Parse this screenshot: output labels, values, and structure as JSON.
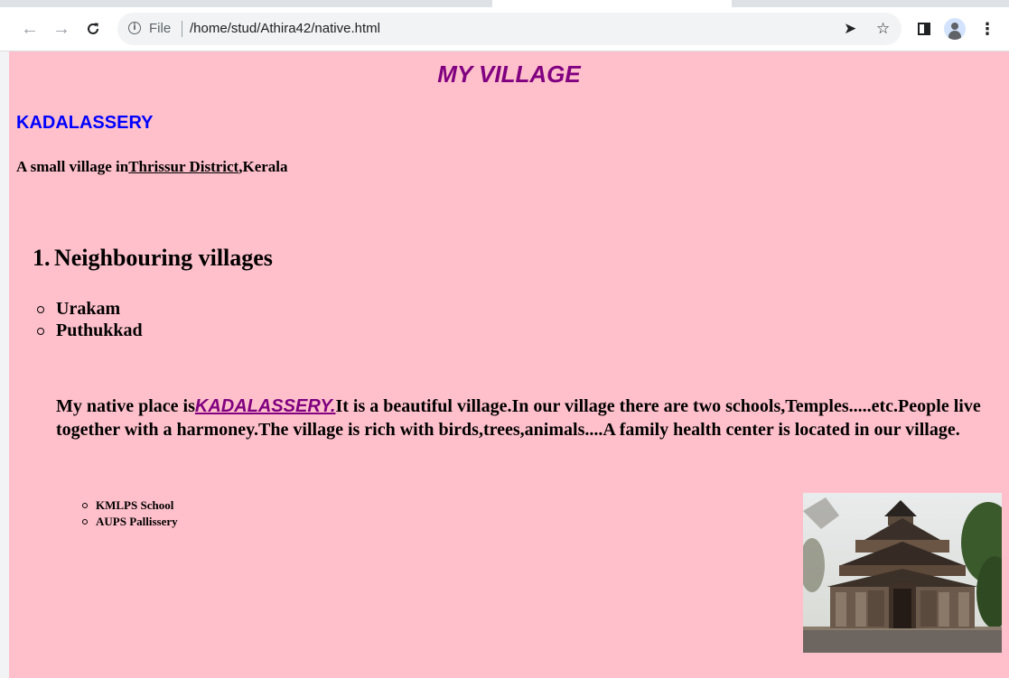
{
  "browser": {
    "url_scheme": "File",
    "url_path": "/home/stud/Athira42/native.html",
    "icons": {
      "back": "arrow-left-icon",
      "forward": "arrow-right-icon",
      "reload": "reload-icon",
      "info": "info-icon",
      "send": "send-icon",
      "bookmark": "star-icon",
      "side_panel": "side-panel-icon",
      "profile": "avatar-icon",
      "menu": "kebab-menu-icon"
    }
  },
  "page": {
    "background": "#ffc0cb",
    "title": "MY VILLAGE",
    "title_color": "#800080",
    "village_name": "KADALASSERY",
    "village_color": "#0000ff",
    "tagline_prefix": "A small village in",
    "tagline_link": "Thrissur District",
    "tagline_suffix": ",Kerala",
    "ordered_item_number": "1.",
    "ordered_item": "Neighbouring villages",
    "neighbouring_villages": [
      "Urakam",
      "Puthukkad"
    ],
    "paragraph_prefix": "My native place is",
    "paragraph_link": "KADALASSERY.",
    "paragraph_rest": "It is a beautiful village.In our village there are two schools,Temples.....etc.People live together with a harmoney.The village is rich with birds,trees,animals....A family health center is located in our village.",
    "schools": [
      "KMLPS School",
      "AUPS Pallissery"
    ]
  }
}
